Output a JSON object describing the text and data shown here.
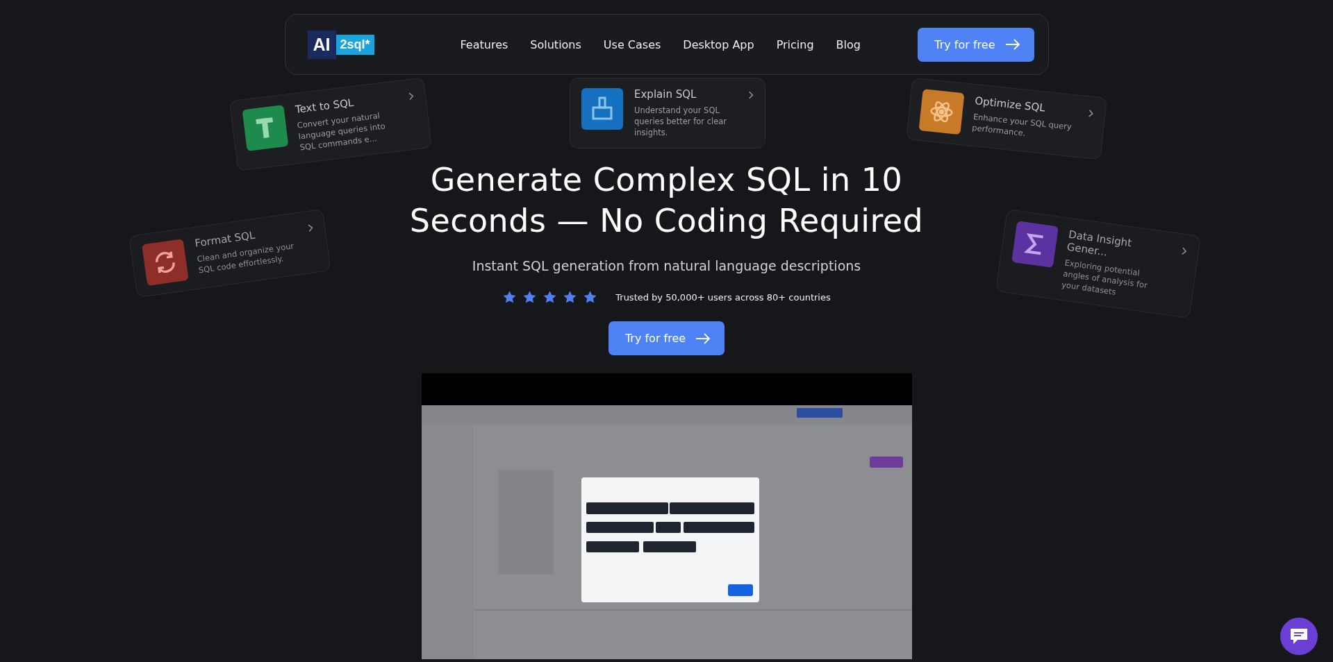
{
  "nav": {
    "logo": {
      "left": "AI",
      "right": "2sql*"
    },
    "links": [
      "Features",
      "Solutions",
      "Use Cases",
      "Desktop App",
      "Pricing",
      "Blog"
    ],
    "cta": "Try for free"
  },
  "feature_cards": [
    {
      "kind": "text",
      "color": "#1e8a4c",
      "title": "Text to SQL",
      "description": "Convert your natural language queries into SQL commands e..."
    },
    {
      "kind": "brush",
      "color": "#1570c0",
      "title": "Explain SQL",
      "description": "Understand your SQL queries better for clear insights."
    },
    {
      "kind": "atom",
      "color": "#c97a28",
      "title": "Optimize SQL",
      "description": "Enhance your SQL query performance."
    },
    {
      "kind": "refresh",
      "color": "#8e2e29",
      "title": "Format SQL",
      "description": "Clean and organize your SQL code effortlessly."
    },
    {
      "kind": "sigma",
      "color": "#5b32a0",
      "title": "Data Insight Gener...",
      "description": "Exploring potential angles of analysis for your datasets"
    }
  ],
  "hero": {
    "title_lines": [
      "Generate Complex SQL in 10",
      "Seconds — No Coding Required"
    ],
    "subtitle": "Instant SQL generation from natural language descriptions",
    "stars": 5,
    "trust": "Trusted by 50,000+ users across 80+ countries",
    "cta": "Try for free"
  }
}
